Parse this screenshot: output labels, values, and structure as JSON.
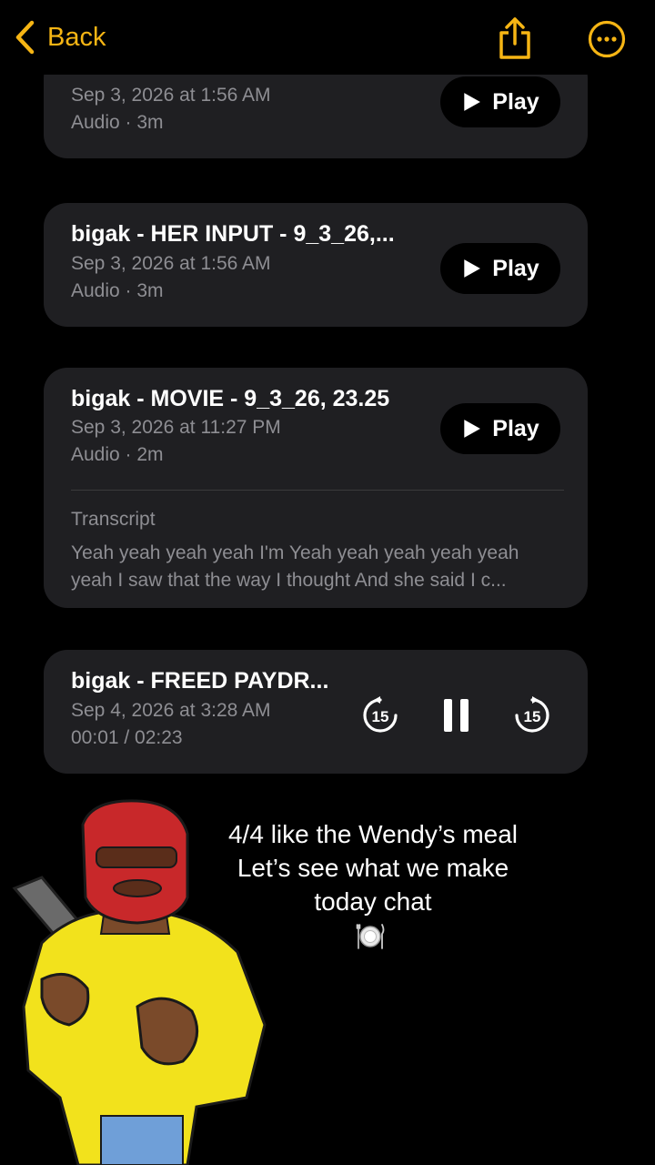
{
  "nav": {
    "back_label": "Back"
  },
  "recordings": [
    {
      "title": "",
      "date": "Sep 3, 2026 at 1:56 AM",
      "info": "Audio · 3m",
      "play_label": "Play"
    },
    {
      "title": "bigak - HER INPUT - 9_3_26,...",
      "date": "Sep 3, 2026 at 1:56 AM",
      "info": "Audio · 3m",
      "play_label": "Play"
    },
    {
      "title": "bigak - MOVIE - 9_3_26, 23.25",
      "date": "Sep 3, 2026 at 11:27 PM",
      "info": "Audio · 2m",
      "play_label": "Play",
      "transcript_label": "Transcript",
      "transcript_lines": [
        "Yeah yeah yeah yeah I'm Yeah yeah yeah yeah yeah",
        "yeah I saw that the way I thought And she said I c..."
      ]
    },
    {
      "title": "bigak - FREED PAYDR...",
      "date": "Sep 4, 2026 at 3:28 AM",
      "progress": "00:01 / 02:23",
      "skip_back_seconds": "15",
      "skip_forward_seconds": "15"
    }
  ],
  "caption": {
    "lines": [
      "4/4 like the Wendy’s meal",
      "Let’s see what we make",
      "today chat"
    ],
    "emoji": "plate-icon"
  },
  "colors": {
    "accent": "#f6b514",
    "card": "#1f1f22",
    "secondary_text": "#8e8e93"
  }
}
